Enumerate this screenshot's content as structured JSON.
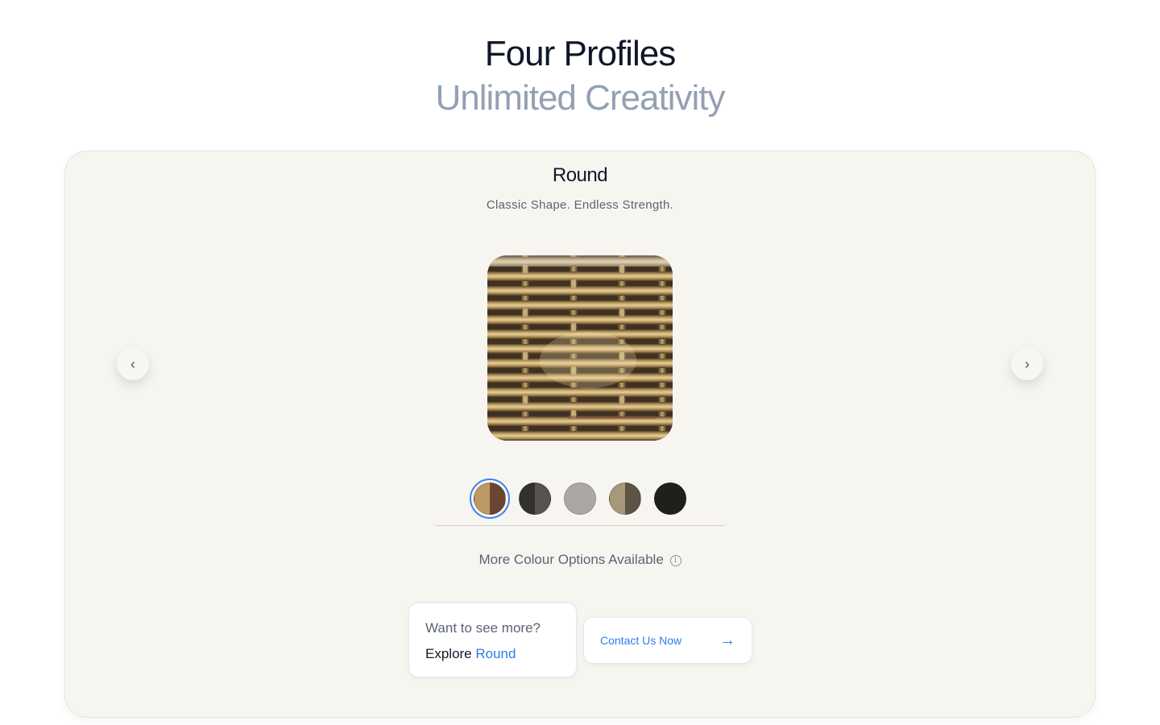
{
  "heading": {
    "line1": "Four Profiles",
    "line2": "Unlimited Creativity"
  },
  "profile": {
    "title": "Round",
    "subtitle": "Classic Shape. Endless Strength."
  },
  "navigation": {
    "prev_symbol": "‹",
    "next_symbol": "›"
  },
  "swatches": [
    {
      "name": "colour-swatch-natural-brown",
      "left": "#bb9a65",
      "right": "#6a4632",
      "selected": true
    },
    {
      "name": "colour-swatch-charcoal",
      "left": "#323130",
      "right": "#595350",
      "selected": false
    },
    {
      "name": "colour-swatch-grey",
      "left": "#aba8a4",
      "right": "#aba8a4",
      "selected": false
    },
    {
      "name": "colour-swatch-sand-brown",
      "left": "#a8977b",
      "right": "#5e5344",
      "selected": false
    },
    {
      "name": "colour-swatch-black",
      "left": "#1f1f1d",
      "right": "#1f1f1d",
      "selected": false
    }
  ],
  "more_colours": {
    "label": "More Colour Options Available",
    "info_symbol": "i"
  },
  "explore": {
    "question": "Want to see more?",
    "prefix": "Explore",
    "link": "Round"
  },
  "contact": {
    "label": "Contact Us Now",
    "arrow": "→"
  },
  "colors": {
    "accent": "#2b7de9",
    "card_bg": "#f7f5f0",
    "selected_ring": "#3b82f6"
  }
}
